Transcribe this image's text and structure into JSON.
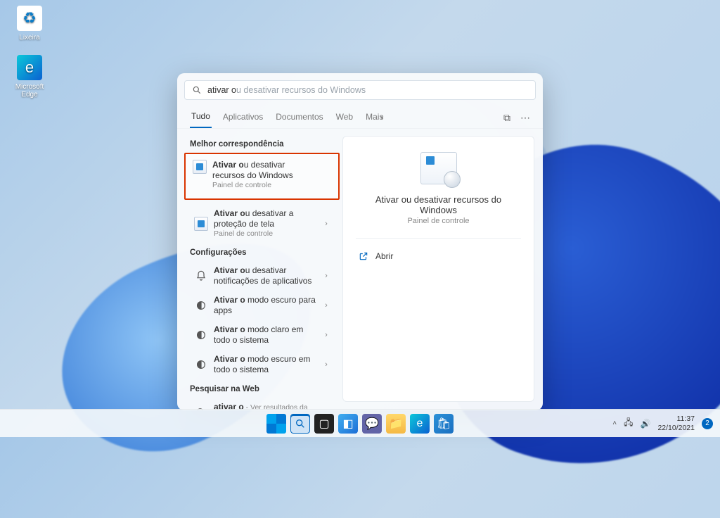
{
  "desktop": {
    "recycle_label": "Lixeira",
    "edge_label": "Microsoft Edge"
  },
  "search": {
    "query_typed": "ativar o",
    "query_suggestion": "u desativar recursos do Windows",
    "tabs": {
      "all": "Tudo",
      "apps": "Aplicativos",
      "docs": "Documentos",
      "web": "Web",
      "more": "Mais"
    },
    "sections": {
      "best_match": "Melhor correspondência",
      "settings": "Configurações",
      "web": "Pesquisar na Web"
    },
    "best": {
      "bold": "Ativar o",
      "rest": "u desativar recursos do Windows",
      "sub": "Painel de controle"
    },
    "second": {
      "bold": "Ativar o",
      "rest": "u desativar a proteção de tela",
      "sub": "Painel de controle"
    },
    "settings_list": [
      {
        "bold": "Ativar o",
        "rest": "u desativar notificações de aplicativos"
      },
      {
        "bold": "Ativar o",
        "rest": " modo escuro para apps"
      },
      {
        "bold": "Ativar o",
        "rest": " modo claro em todo o sistema"
      },
      {
        "bold": "Ativar o",
        "rest": " modo escuro em todo o sistema"
      }
    ],
    "web_result": {
      "bold": "ativar o",
      "rest": " - Ver resultados da Web"
    }
  },
  "preview": {
    "title": "Ativar ou desativar recursos do Windows",
    "sub": "Painel de controle",
    "open_label": "Abrir"
  },
  "taskbar": {
    "time": "11:37",
    "date": "22/10/2021",
    "notif_count": "2"
  }
}
